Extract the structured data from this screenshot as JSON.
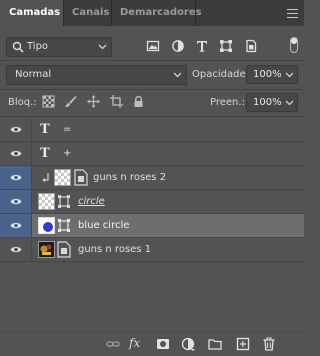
{
  "tabs": [
    {
      "label": "Camadas"
    },
    {
      "label": "Canais"
    },
    {
      "label": "Demarcadores"
    }
  ],
  "filter": {
    "kind_label": "Tipo",
    "icons": [
      "pixel-filter-icon",
      "adjustment-filter-icon",
      "type-filter-icon",
      "shape-filter-icon",
      "smart-object-filter-icon"
    ]
  },
  "blend": {
    "mode": "Normal",
    "opacity_label": "Opacidade:",
    "opacity_value": "100%"
  },
  "lock": {
    "label": "Bloq.:",
    "fill_label": "Preen.:",
    "fill_value": "100%"
  },
  "layers": [
    {
      "name": "=",
      "kind": "text",
      "visible": true,
      "selected": false
    },
    {
      "name": "+",
      "kind": "text",
      "visible": true,
      "selected": false
    },
    {
      "name": "guns n roses 2",
      "kind": "smart-clipped",
      "visible": true,
      "selected": false
    },
    {
      "name": "circle",
      "kind": "shape",
      "visible": true,
      "selected": false
    },
    {
      "name": "blue circle",
      "kind": "shape",
      "visible": true,
      "selected": true
    },
    {
      "name": "guns n roses 1",
      "kind": "smart",
      "visible": true,
      "selected": false
    }
  ],
  "bottom_bar": {
    "fx_label": "fx",
    "icons": [
      "link-layers-icon",
      "fx-icon",
      "add-mask-icon",
      "new-adjustment-icon",
      "new-group-icon",
      "new-layer-icon",
      "delete-layer-icon"
    ]
  }
}
